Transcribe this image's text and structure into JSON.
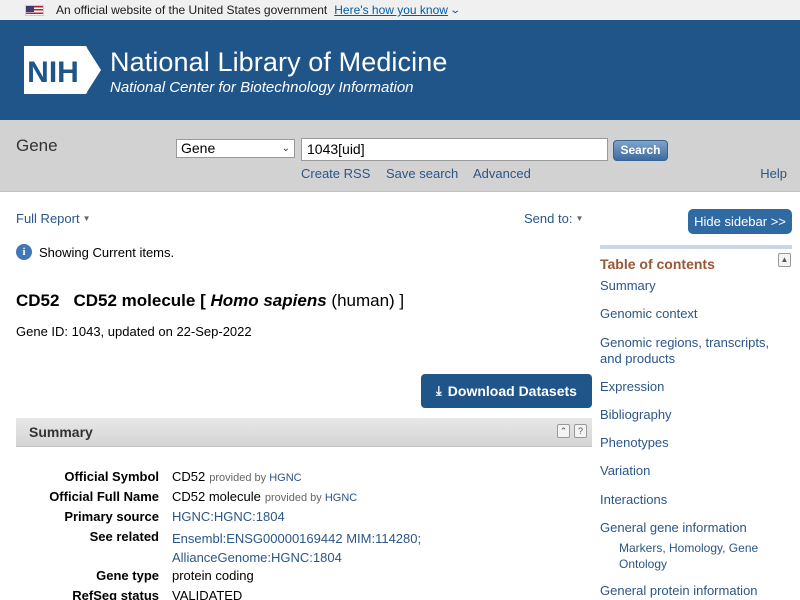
{
  "gov_banner": {
    "text": "An official website of the United States government",
    "link": "Here's how you know"
  },
  "header": {
    "logo_text": "NIH",
    "title": "National Library of Medicine",
    "subtitle": "National Center for Biotechnology Information"
  },
  "search": {
    "db_label": "Gene",
    "db_selected": "Gene",
    "query": "1043[uid]",
    "button": "Search",
    "links": [
      "Create RSS",
      "Save search",
      "Advanced"
    ],
    "help": "Help"
  },
  "toolbar": {
    "full_report": "Full Report",
    "send_to": "Send to:",
    "hide_sidebar": "Hide sidebar >>"
  },
  "notice": "Showing Current items.",
  "gene": {
    "symbol": "CD52",
    "name": "CD52 molecule [",
    "species": "Homo sapiens",
    "species_common": "(human) ]",
    "id_line": "Gene ID: 1043, updated on 22-Sep-2022",
    "download": "Download Datasets"
  },
  "summary": {
    "heading": "Summary",
    "rows": [
      {
        "label": "Official Symbol",
        "value": "CD52",
        "provided_by": "provided by",
        "provider": "HGNC"
      },
      {
        "label": "Official Full Name",
        "value": "CD52 molecule",
        "provided_by": "provided by",
        "provider": "HGNC"
      },
      {
        "label": "Primary source",
        "value": "HGNC:HGNC:1804"
      },
      {
        "label": "See related",
        "value1": "Ensembl:ENSG00000169442",
        "value2": "MIM:114280;",
        "value3": "AllianceGenome:HGNC:1804"
      },
      {
        "label": "Gene type",
        "value": "protein coding"
      },
      {
        "label": "RefSeq status",
        "value": "VALIDATED"
      }
    ]
  },
  "toc": {
    "heading": "Table of contents",
    "items": [
      "Summary",
      "Genomic context",
      "Genomic regions, transcripts, and products",
      "Expression",
      "Bibliography",
      "Phenotypes",
      "Variation",
      "Interactions",
      "General gene information",
      "Markers, Homology, Gene Ontology",
      "General protein information"
    ]
  },
  "colors": {
    "header_bg": "#20558a",
    "link": "#2b5688",
    "toc_heading": "#985735"
  }
}
